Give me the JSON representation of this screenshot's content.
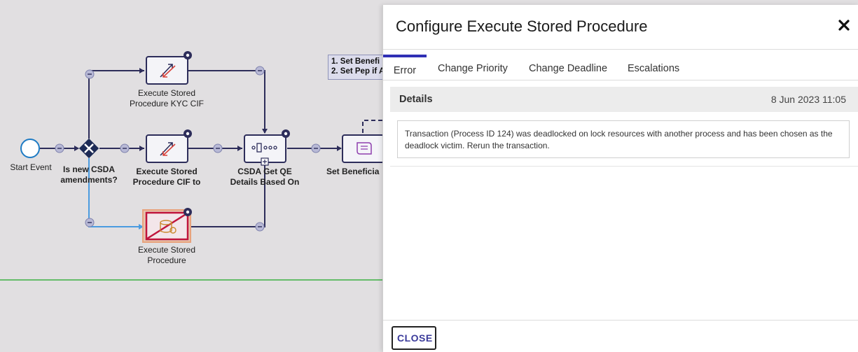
{
  "canvas": {
    "nodes": {
      "start_event": "Start Event",
      "gateway_line1": "Is new CSDA",
      "gateway_line2": "amendments?",
      "sp_kyc_line1": "Execute Stored",
      "sp_kyc_line2": "Procedure KYC CIF",
      "sp_cif_line1": "Execute Stored",
      "sp_cif_line2": "Procedure CIF to",
      "sp_plain_line1": "Execute Stored",
      "sp_plain_line2": "Procedure",
      "csda_line1": "CSDA Get QE",
      "csda_line2": "Details Based On",
      "set_beneficiary": "Set Beneficia"
    },
    "note": {
      "line1": "1. Set Benefi",
      "line2": "2. Set Pep if A"
    },
    "colors": {
      "flow_line": "#2d2d5a",
      "selected_flow": "#4a9be0",
      "error_node": "#c0143c",
      "divider": "#3cb043"
    }
  },
  "panel": {
    "title": "Configure Execute Stored Procedure",
    "close_icon": "close-icon",
    "tabs": [
      {
        "label": "Error",
        "active": true
      },
      {
        "label": "Change Priority",
        "active": false
      },
      {
        "label": "Change Deadline",
        "active": false
      },
      {
        "label": "Escalations",
        "active": false
      }
    ],
    "details": {
      "title": "Details",
      "date": "8 Jun 2023 11:05",
      "message": "Transaction (Process ID 124) was deadlocked on lock resources with another process and has been chosen as the deadlock victim. Rerun the transaction."
    },
    "footer": {
      "close_label": "CLOSE"
    },
    "colors": {
      "accent": "#2f2fb5"
    }
  }
}
